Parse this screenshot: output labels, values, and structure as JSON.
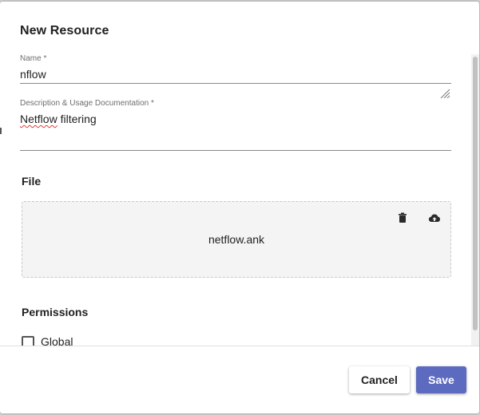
{
  "dialog": {
    "title": "New Resource"
  },
  "form": {
    "name": {
      "label": "Name *",
      "value": "nflow"
    },
    "description": {
      "label": "Description & Usage Documentation *",
      "value_misspelled": "Netflow",
      "value_rest": " filtering"
    }
  },
  "file_section": {
    "title": "File",
    "filename": "netflow.ank",
    "delete_icon": "trash-icon",
    "upload_icon": "cloud-upload-icon"
  },
  "permissions_section": {
    "title": "Permissions",
    "global_label": "Global",
    "global_checked": false
  },
  "footer": {
    "cancel_label": "Cancel",
    "save_label": "Save"
  },
  "colors": {
    "primary": "#5c6bc0",
    "dropzone_bg": "#f4f4f4"
  }
}
